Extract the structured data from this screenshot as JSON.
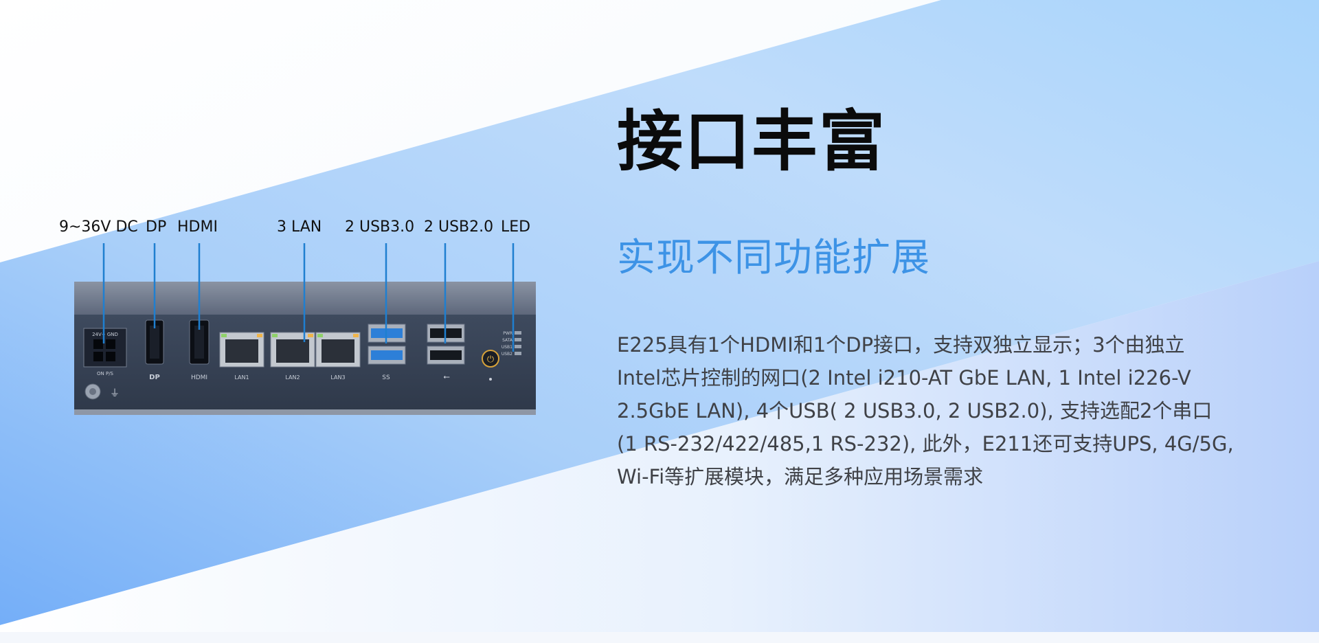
{
  "title": "接口丰富",
  "subtitle": "实现不同功能扩展",
  "description_lines": [
    "E225具有1个HDMI和1个DP接口，支持双独立显示；3个由独立",
    "Intel芯片控制的网口(2 Intel i210-AT GbE LAN, 1 Intel i226-V",
    "2.5GbE LAN), 4个USB( 2 USB3.0, 2 USB2.0), 支持选配2个串口",
    "(1 RS-232/422/485,1 RS-232), 此外，E211还可支持UPS, 4G/5G,",
    "Wi-Fi等扩展模块，满足多种应用场景需求"
  ],
  "port_labels": {
    "dc": "9~36V DC",
    "dp": "DP",
    "hdmi": "HDMI",
    "lan": "3 LAN",
    "usb3": "2 USB3.0",
    "usb2": "2 USB2.0",
    "led": "LED"
  },
  "panel_marks": {
    "pwr_top": "24V+ GND",
    "pwr_bottom": "ON P/S",
    "dp_logo": "DP",
    "hdmi_logo": "HDMI",
    "lan1": "LAN1",
    "lan2": "LAN2",
    "lan3": "LAN3",
    "usb3_logo": "SS",
    "leds": [
      "PWR",
      "SATA",
      "USB1",
      "USB2"
    ]
  },
  "colors": {
    "accent_blue": "#3d93e6",
    "callout_line": "#1f7fd0",
    "chassis": "#3b4558",
    "usb3_blue": "#2d7fd8"
  }
}
